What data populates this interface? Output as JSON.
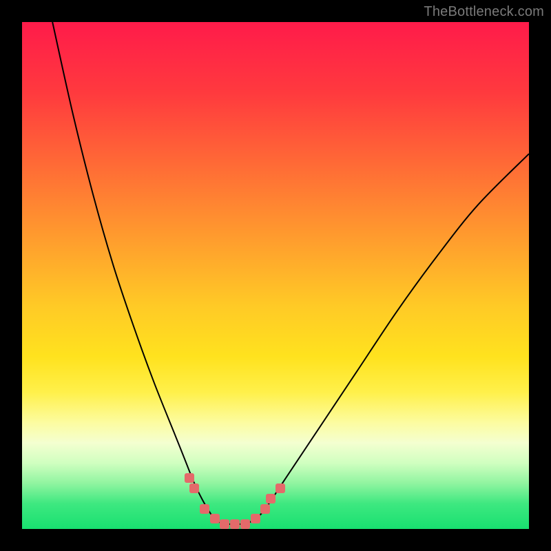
{
  "watermark": "TheBottleneck.com",
  "chart_data": {
    "type": "line",
    "title": "",
    "xlabel": "",
    "ylabel": "",
    "xlim": [
      0,
      100
    ],
    "ylim": [
      0,
      100
    ],
    "grid": false,
    "legend": false,
    "gradient_stops": [
      {
        "pct": 0,
        "color": "#ff1b4a"
      },
      {
        "pct": 14,
        "color": "#ff3a3e"
      },
      {
        "pct": 28,
        "color": "#ff6a36"
      },
      {
        "pct": 42,
        "color": "#ff9a2e"
      },
      {
        "pct": 56,
        "color": "#ffca26"
      },
      {
        "pct": 66,
        "color": "#ffe21e"
      },
      {
        "pct": 73,
        "color": "#fff04a"
      },
      {
        "pct": 79,
        "color": "#fcfca0"
      },
      {
        "pct": 83,
        "color": "#f4ffd0"
      },
      {
        "pct": 87,
        "color": "#d0ffc0"
      },
      {
        "pct": 91,
        "color": "#90f4a0"
      },
      {
        "pct": 95,
        "color": "#3ee880"
      },
      {
        "pct": 100,
        "color": "#18e070"
      }
    ],
    "series": [
      {
        "name": "bottleneck-curve",
        "color": "#000000",
        "points": [
          {
            "x": 6,
            "y": 100
          },
          {
            "x": 10,
            "y": 82
          },
          {
            "x": 14,
            "y": 66
          },
          {
            "x": 18,
            "y": 52
          },
          {
            "x": 22,
            "y": 40
          },
          {
            "x": 26,
            "y": 29
          },
          {
            "x": 30,
            "y": 19
          },
          {
            "x": 32,
            "y": 14
          },
          {
            "x": 34,
            "y": 9
          },
          {
            "x": 36,
            "y": 5
          },
          {
            "x": 38,
            "y": 2
          },
          {
            "x": 40,
            "y": 1
          },
          {
            "x": 42,
            "y": 1
          },
          {
            "x": 44,
            "y": 1
          },
          {
            "x": 46,
            "y": 2
          },
          {
            "x": 48,
            "y": 4
          },
          {
            "x": 52,
            "y": 10
          },
          {
            "x": 58,
            "y": 19
          },
          {
            "x": 66,
            "y": 31
          },
          {
            "x": 74,
            "y": 43
          },
          {
            "x": 82,
            "y": 54
          },
          {
            "x": 90,
            "y": 64
          },
          {
            "x": 100,
            "y": 74
          }
        ]
      }
    ],
    "markers": [
      {
        "x": 33,
        "y": 10
      },
      {
        "x": 34,
        "y": 8
      },
      {
        "x": 36,
        "y": 4
      },
      {
        "x": 38,
        "y": 2
      },
      {
        "x": 40,
        "y": 1
      },
      {
        "x": 42,
        "y": 1
      },
      {
        "x": 44,
        "y": 1
      },
      {
        "x": 46,
        "y": 2
      },
      {
        "x": 48,
        "y": 4
      },
      {
        "x": 49,
        "y": 6
      },
      {
        "x": 51,
        "y": 8
      }
    ]
  }
}
